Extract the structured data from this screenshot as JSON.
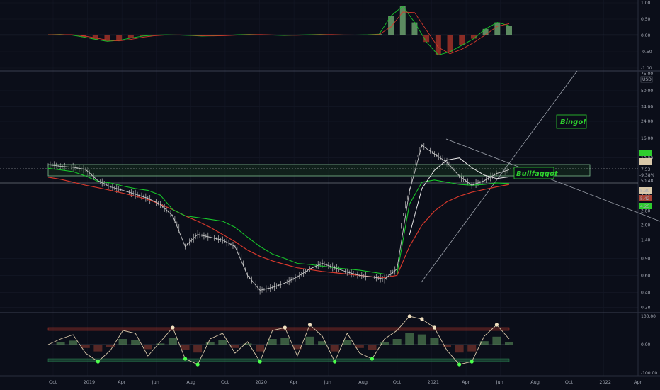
{
  "colors": {
    "background": "#0b0e19",
    "grid": "#1c2030",
    "separator": "#3a3f50",
    "candle": "#c9c9c9",
    "ma_green": "#17c52a",
    "ma_red": "#d4382c",
    "ma_white": "#e8e8e8",
    "box_fill": "#16301e",
    "box_stroke": "#7fbf8f",
    "trendline": "#9ea3ad",
    "annotation_green": "#2ed12e",
    "hist_green": "#7fbf7f",
    "hist_red": "#c0392b",
    "tag_price": "#ffffff",
    "tag_green": "#2ecc2e",
    "tag_tan": "#d9c8a9",
    "tag_red": "#a94436"
  },
  "annotations": {
    "bingo": "Bingo!",
    "bullf": "Bullfaggot"
  },
  "price_tags": {
    "last_price": "7.53",
    "change": "-9.38%",
    "countdown": "50:48",
    "tag_a": "5.30",
    "tag_b": "5.42",
    "tag_c": "4.25",
    "currency": "USD",
    "top_label": "75.00"
  },
  "chart_data": [
    {
      "type": "line",
      "panel": "oscillator-top",
      "y_ticks": [
        "1.00",
        "0.50",
        "0.00",
        "-0.50",
        "-1.00"
      ],
      "ylim": [
        -1.0,
        1.0
      ],
      "series": [
        {
          "values": [
            0.02,
            0.03,
            0.01,
            -0.05,
            -0.12,
            -0.18,
            -0.15,
            -0.08,
            -0.02,
            0.01,
            0.02,
            0.01,
            0.0,
            -0.02,
            -0.01,
            0.0,
            0.02,
            0.03,
            0.02,
            0.01,
            0.0,
            0.01,
            0.02,
            0.03,
            0.02,
            0.01,
            0.01,
            0.02,
            0.04,
            0.6,
            0.9,
            0.4,
            -0.2,
            -0.6,
            -0.5,
            -0.3,
            -0.1,
            0.2,
            0.4,
            0.3
          ]
        }
      ]
    },
    {
      "type": "line",
      "panel": "price",
      "scale": "log",
      "y_ticks": [
        "50.00",
        "34.00",
        "24.00",
        "16.00",
        "10.00",
        "4.00",
        "2.80",
        "2.00",
        "1.40",
        "0.90",
        "0.60",
        "0.40",
        "0.28"
      ],
      "x_ticks": [
        "Oct",
        "2019",
        "Apr",
        "Jun",
        "Aug",
        "Oct",
        "2020",
        "Apr",
        "Jun",
        "Aug",
        "Oct",
        "2021",
        "Apr",
        "Jun",
        "Aug",
        "Oct",
        "2022",
        "Apr"
      ],
      "ylim": [
        0.25,
        75.0
      ],
      "series": [
        {
          "values": [
            8.5,
            8.2,
            8.0,
            7.6,
            5.8,
            5.0,
            4.6,
            4.2,
            3.8,
            3.3,
            2.5,
            1.2,
            1.6,
            1.5,
            1.4,
            1.2,
            0.6,
            0.42,
            0.45,
            0.5,
            0.58,
            0.7,
            0.8,
            0.72,
            0.65,
            0.6,
            0.58,
            0.55,
            0.7,
            4.5,
            13.5,
            11.0,
            9.0,
            6.5,
            5.2,
            5.8,
            6.9,
            7.53
          ]
        },
        {
          "name": "",
          "values": [
            7.8,
            7.5,
            7.2,
            6.5,
            5.7,
            5.5,
            5.1,
            4.8,
            4.6,
            4.1,
            2.9,
            2.5,
            2.4,
            2.3,
            2.2,
            1.9,
            1.5,
            1.2,
            1.0,
            0.9,
            0.8,
            0.78,
            0.75,
            0.72,
            0.7,
            0.68,
            0.65,
            0.62,
            0.62,
            3.3,
            5.6,
            5.9,
            5.6,
            5.3,
            5.2,
            5.3,
            5.5,
            5.42
          ]
        },
        {
          "name": "",
          "values": [
            6.3,
            6.0,
            5.6,
            5.2,
            4.9,
            4.6,
            4.3,
            4.0,
            3.7,
            3.3,
            2.9,
            2.5,
            2.2,
            1.9,
            1.6,
            1.35,
            1.1,
            0.95,
            0.85,
            0.78,
            0.72,
            0.69,
            0.66,
            0.64,
            0.62,
            0.6,
            0.58,
            0.57,
            0.6,
            1.2,
            2.0,
            2.8,
            3.5,
            4.0,
            4.4,
            4.7,
            5.0,
            5.3
          ]
        }
      ]
    },
    {
      "type": "line",
      "panel": "oscillator-bottom",
      "y_ticks": [
        "100.00",
        "0.00",
        "-100.00"
      ],
      "ylim": [
        -100,
        100
      ],
      "series": [
        {
          "values": [
            0,
            20,
            35,
            -30,
            -60,
            -20,
            50,
            40,
            -40,
            10,
            60,
            -50,
            -70,
            20,
            40,
            -30,
            10,
            -60,
            50,
            60,
            -40,
            70,
            30,
            -60,
            40,
            -30,
            -50,
            20,
            50,
            100,
            90,
            60,
            -20,
            -70,
            -60,
            30,
            70,
            20
          ]
        }
      ]
    }
  ]
}
